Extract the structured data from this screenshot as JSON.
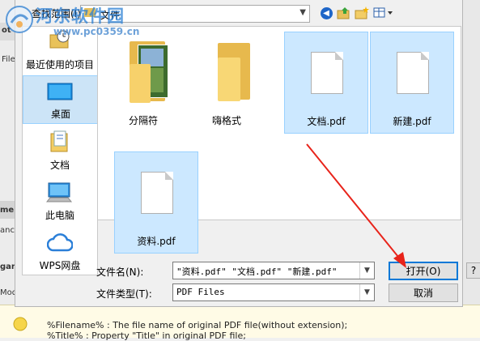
{
  "dialog": {
    "look_in_label": "查找范围(I):",
    "look_in_value": "文件"
  },
  "places": [
    {
      "label": "最近使用的项目",
      "icon": "recent-icon"
    },
    {
      "label": "桌面",
      "icon": "desktop-icon"
    },
    {
      "label": "文档",
      "icon": "documents-icon"
    },
    {
      "label": "此电脑",
      "icon": "computer-icon"
    },
    {
      "label": "WPS网盘",
      "icon": "cloud-icon"
    }
  ],
  "files": [
    {
      "name": "分隔符",
      "type": "folder-with-image",
      "selected": false
    },
    {
      "name": "嗨格式",
      "type": "folder",
      "selected": false
    },
    {
      "name": "文档.pdf",
      "type": "pdf",
      "selected": true
    },
    {
      "name": "新建.pdf",
      "type": "pdf",
      "selected": true
    },
    {
      "name": "资料.pdf",
      "type": "pdf",
      "selected": true
    }
  ],
  "filename_label": "文件名(N):",
  "filename_value": "\"资料.pdf\" \"文档.pdf\" \"新建.pdf\"",
  "filetype_label": "文件类型(T):",
  "filetype_value": "PDF Files",
  "open_button": "打开(O)",
  "cancel_button": "取消",
  "background": {
    "left_labels": [
      "ot",
      "File",
      "me",
      "ance",
      "gan",
      "Mod"
    ],
    "right_button": "?",
    "bottom_line1": "%Filename% : The file name of original PDF file(without extension);",
    "bottom_line2": "%Title% : Property \"Title\" in original PDF file;"
  },
  "watermark": {
    "title": "河东软件园",
    "url": "www.pc0359.cn"
  },
  "colors": {
    "selection": "#cce8ff",
    "selection_border": "#99d1ff",
    "arrow": "#e8231a",
    "accent": "#0078d7"
  }
}
